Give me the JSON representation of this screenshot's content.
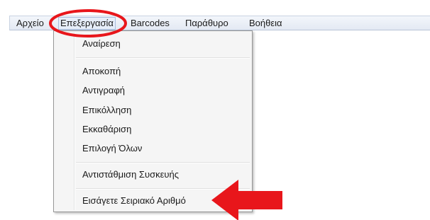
{
  "menubar": {
    "items": [
      {
        "label": "Αρχείο"
      },
      {
        "label": "Επεξεργασία"
      },
      {
        "label": "Barcodes"
      },
      {
        "label": "Παράθυρο"
      },
      {
        "label": "Βοήθεια"
      }
    ]
  },
  "edit_menu": {
    "items": [
      {
        "label": "Αναίρεση"
      },
      {
        "label": "Αποκοπή"
      },
      {
        "label": "Αντιγραφή"
      },
      {
        "label": "Επικόλληση"
      },
      {
        "label": "Εκκαθάριση"
      },
      {
        "label": "Επιλογή Όλων"
      },
      {
        "label": "Αντιστάθμιση Συσκευής"
      },
      {
        "label": "Εισάγετε Σειριακό Αριθμό"
      }
    ]
  },
  "annotations": {
    "highlight_color": "#e8161b"
  }
}
